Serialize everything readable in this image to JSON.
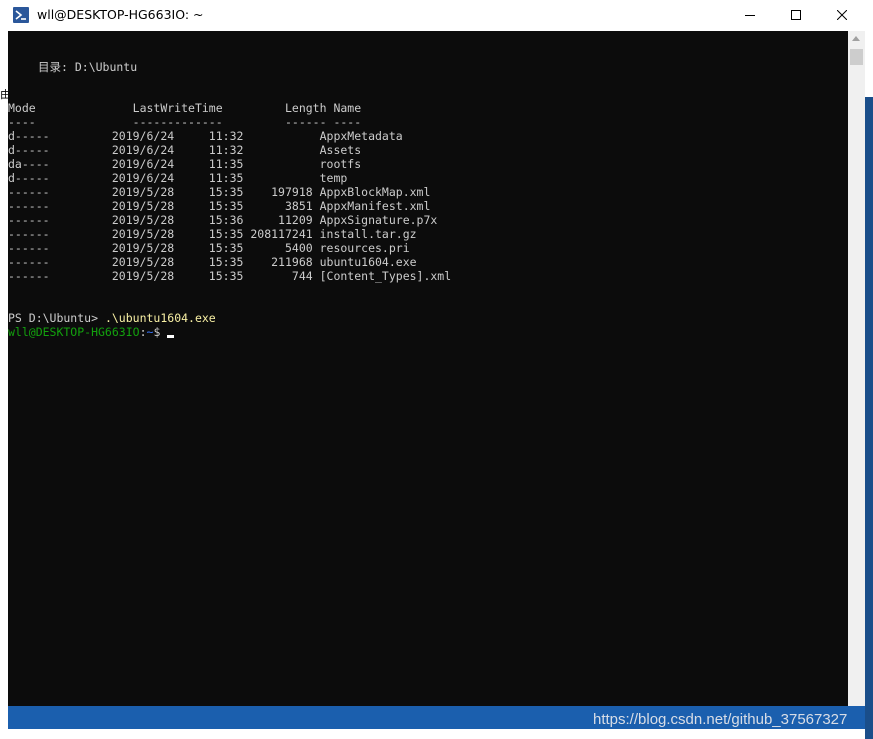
{
  "window": {
    "title": "wll@DESKTOP-HG663IO: ~",
    "icon": "powershell-icon",
    "controls": {
      "minimize": "minimize-icon",
      "maximize": "maximize-icon",
      "close": "close-icon"
    }
  },
  "terminal": {
    "directory_line": "目录: D:\\Ubuntu",
    "glyph_fragment": "由",
    "table": {
      "headers": {
        "mode": "Mode",
        "lastwritetime": "LastWriteTime",
        "length": "Length",
        "name": "Name"
      },
      "separator": {
        "mode": "----",
        "lastwritetime": "-------------",
        "length": "------",
        "name": "----"
      },
      "rows": [
        {
          "mode": "d-----",
          "date": "2019/6/24",
          "time": "11:32",
          "length": "",
          "name": "AppxMetadata"
        },
        {
          "mode": "d-----",
          "date": "2019/6/24",
          "time": "11:32",
          "length": "",
          "name": "Assets"
        },
        {
          "mode": "da----",
          "date": "2019/6/24",
          "time": "11:35",
          "length": "",
          "name": "rootfs"
        },
        {
          "mode": "d-----",
          "date": "2019/6/24",
          "time": "11:35",
          "length": "",
          "name": "temp"
        },
        {
          "mode": "------",
          "date": "2019/5/28",
          "time": "15:35",
          "length": "197918",
          "name": "AppxBlockMap.xml"
        },
        {
          "mode": "------",
          "date": "2019/5/28",
          "time": "15:35",
          "length": "3851",
          "name": "AppxManifest.xml"
        },
        {
          "mode": "------",
          "date": "2019/5/28",
          "time": "15:36",
          "length": "11209",
          "name": "AppxSignature.p7x"
        },
        {
          "mode": "------",
          "date": "2019/5/28",
          "time": "15:35",
          "length": "208117241",
          "name": "install.tar.gz"
        },
        {
          "mode": "------",
          "date": "2019/5/28",
          "time": "15:35",
          "length": "5400",
          "name": "resources.pri"
        },
        {
          "mode": "------",
          "date": "2019/5/28",
          "time": "15:35",
          "length": "211968",
          "name": "ubuntu1604.exe"
        },
        {
          "mode": "------",
          "date": "2019/5/28",
          "time": "15:35",
          "length": "744",
          "name": "[Content_Types].xml"
        }
      ]
    },
    "ps_prompt": "PS D:\\Ubuntu>",
    "ps_command": ".\\ubuntu1604.exe",
    "bash_user": "wll@DESKTOP-HG663IO",
    "bash_colon": ":",
    "bash_path": "~",
    "bash_dollar": "$",
    "colors": {
      "background": "#0c0c0c",
      "text": "#cccccc",
      "command": "#f9f1a5",
      "user": "#13a10e",
      "path": "#3b78ff"
    }
  },
  "watermark": "https://blog.csdn.net/github_37567327"
}
